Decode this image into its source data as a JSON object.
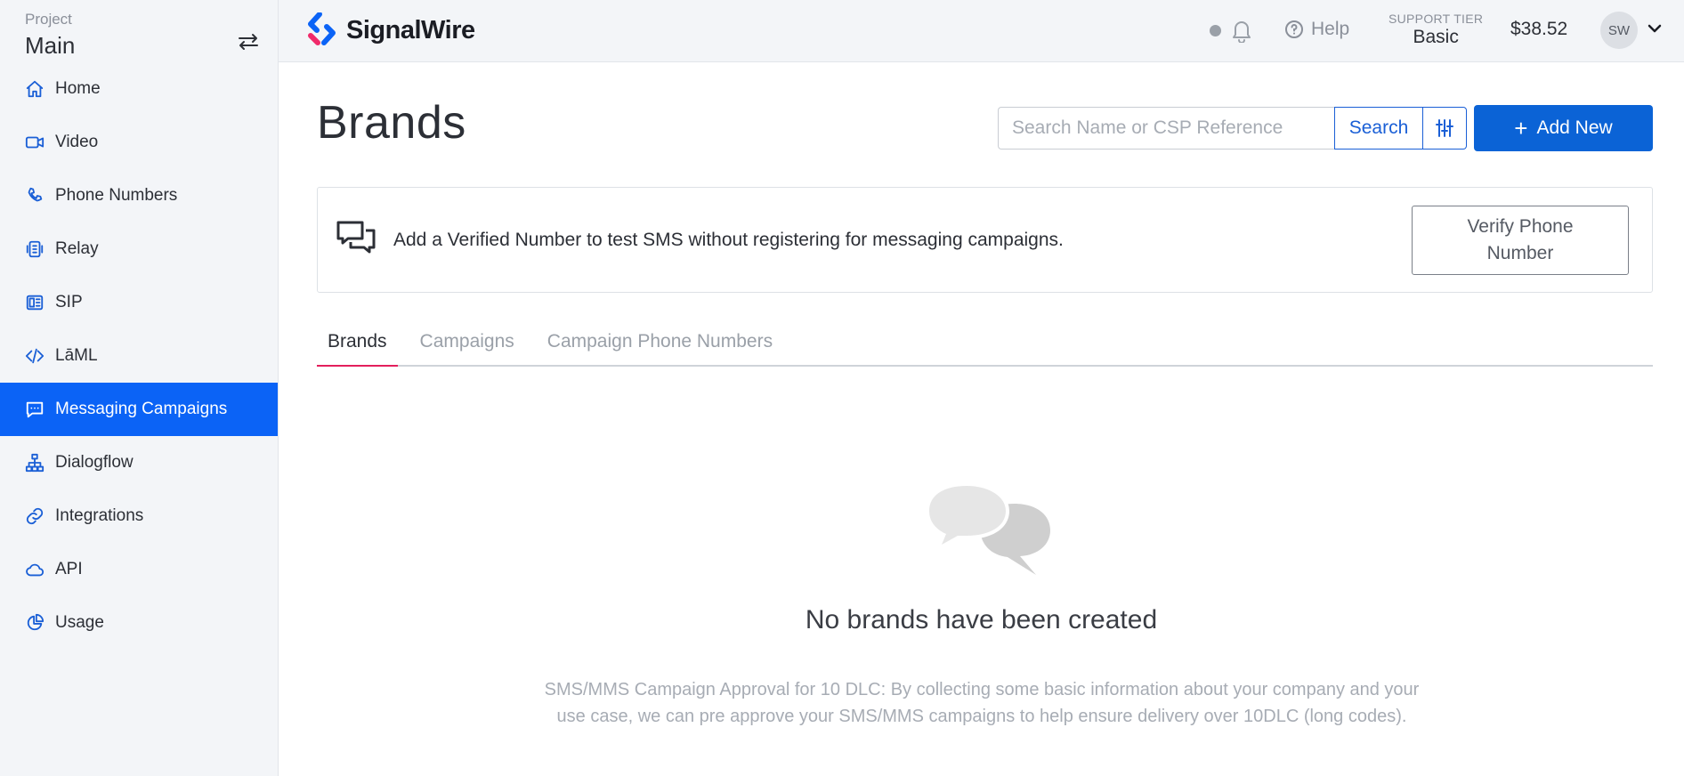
{
  "sidebar": {
    "project_label": "Project",
    "project_name": "Main",
    "items": [
      {
        "label": "Home",
        "icon": "home-icon"
      },
      {
        "label": "Video",
        "icon": "video-icon"
      },
      {
        "label": "Phone Numbers",
        "icon": "phone-icon"
      },
      {
        "label": "Relay",
        "icon": "relay-icon"
      },
      {
        "label": "SIP",
        "icon": "sip-icon"
      },
      {
        "label": "LāML",
        "icon": "code-icon"
      },
      {
        "label": "Messaging Campaigns",
        "icon": "message-icon",
        "active": true
      },
      {
        "label": "Dialogflow",
        "icon": "sitemap-icon"
      },
      {
        "label": "Integrations",
        "icon": "link-icon"
      },
      {
        "label": "API",
        "icon": "cloud-icon"
      },
      {
        "label": "Usage",
        "icon": "pie-chart-icon"
      }
    ]
  },
  "header": {
    "brand": "SignalWire",
    "help_label": "Help",
    "support_tier_label": "SUPPORT TIER",
    "support_tier_value": "Basic",
    "balance": "$38.52",
    "avatar_initials": "SW"
  },
  "main": {
    "title": "Brands",
    "search_placeholder": "Search Name or CSP Reference",
    "search_button": "Search",
    "add_button": "Add New",
    "notice_text": "Add a Verified Number to test SMS without registering for messaging campaigns.",
    "verify_button_line1": "Verify Phone",
    "verify_button_line2": "Number",
    "tabs": [
      {
        "label": "Brands",
        "active": true
      },
      {
        "label": "Campaigns"
      },
      {
        "label": "Campaign Phone Numbers"
      }
    ],
    "empty_title": "No brands have been created",
    "empty_description": "SMS/MMS Campaign Approval for 10 DLC: By collecting some basic information about your company and your use case, we can pre approve your SMS/MMS campaigns to help ensure delivery over 10DLC (long codes)."
  },
  "colors": {
    "accent": "#0b63f6",
    "tab_underline": "#e31f5c",
    "sidebar_bg": "#f3f5f8"
  }
}
